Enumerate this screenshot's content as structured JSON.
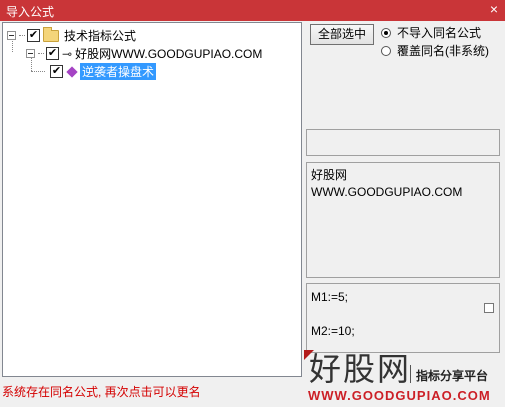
{
  "window": {
    "title": "导入公式",
    "close_glyph": "×"
  },
  "tree": {
    "root": {
      "label": "技术指标公式",
      "checked": true
    },
    "child": {
      "label": "好股网WWW.GOODGUPIAO.COM",
      "checked": true
    },
    "leaf": {
      "label": "逆袭者操盘术",
      "checked": true,
      "selected": true
    }
  },
  "controls": {
    "select_all_label": "全部选中",
    "radio_options": [
      {
        "label": "不导入同名公式",
        "selected": true
      },
      {
        "label": "覆盖同名(非系统)",
        "selected": false
      }
    ]
  },
  "info_panel": {
    "line1": "好股网",
    "line2": "WWW.GOODGUPIAO.COM"
  },
  "code_panel": {
    "line1": "M1:=5;",
    "line2": "M2:=10;"
  },
  "status_text": "系统存在同名公式, 再次点击可以更名",
  "watermark": {
    "brand": "好股网",
    "tagline": "指标分享平台",
    "url": "WWW.GOODGUPIAO.COM"
  },
  "colors": {
    "titlebar": "#c93538",
    "selection": "#3399ff",
    "status": "#d40000",
    "accent": "#cc1f26"
  }
}
